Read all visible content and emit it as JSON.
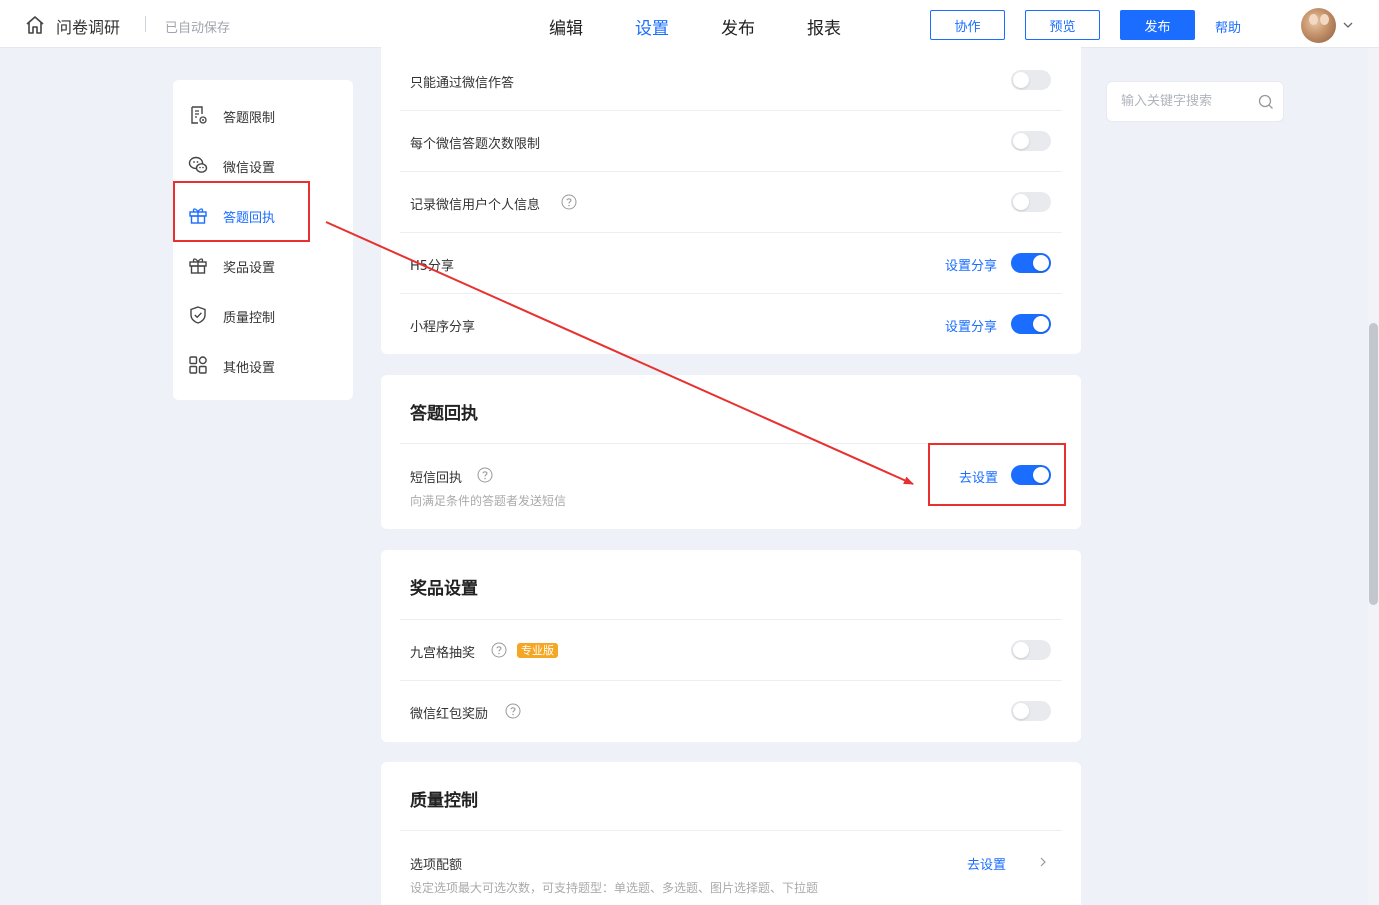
{
  "header": {
    "app_title": "问卷调研",
    "autosave": "已自动保存",
    "tabs": [
      {
        "label": "编辑",
        "active": false
      },
      {
        "label": "设置",
        "active": true
      },
      {
        "label": "发布",
        "active": false
      },
      {
        "label": "报表",
        "active": false
      }
    ],
    "buttons": {
      "collaborate": "协作",
      "preview": "预览",
      "publish": "发布"
    },
    "help": "帮助"
  },
  "sidebar": {
    "items": [
      {
        "label": "答题限制",
        "icon": "doc-settings-icon",
        "active": false
      },
      {
        "label": "微信设置",
        "icon": "wechat-icon",
        "active": false
      },
      {
        "label": "答题回执",
        "icon": "gift-icon",
        "active": true
      },
      {
        "label": "奖品设置",
        "icon": "gift-icon",
        "active": false
      },
      {
        "label": "质量控制",
        "icon": "shield-check-icon",
        "active": false
      },
      {
        "label": "其他设置",
        "icon": "grid-icon",
        "active": false
      }
    ]
  },
  "wechat_section": {
    "rows": [
      {
        "label": "只能通过微信作答",
        "on": false
      },
      {
        "label": "每个微信答题次数限制",
        "on": false
      },
      {
        "label": "记录微信用户个人信息",
        "on": false,
        "help": true
      },
      {
        "label": "H5分享",
        "on": true,
        "link": "设置分享"
      },
      {
        "label": "小程序分享",
        "on": true,
        "link": "设置分享"
      }
    ]
  },
  "receipt_section": {
    "title": "答题回执",
    "sms": {
      "label": "短信回执",
      "desc": "向满足条件的答题者发送短信",
      "link": "去设置",
      "on": true
    }
  },
  "prize_section": {
    "title": "奖品设置",
    "rows": [
      {
        "label": "九宫格抽奖",
        "badge": "专业版",
        "on": false
      },
      {
        "label": "微信红包奖励",
        "on": false
      }
    ]
  },
  "quality_section": {
    "title": "质量控制",
    "option_quota": {
      "label": "选项配额",
      "desc": "设定选项最大可选次数，可支持题型：单选题、多选题、图片选择题、下拉题",
      "link": "去设置"
    }
  },
  "search": {
    "placeholder": "输入关键字搜索"
  },
  "colors": {
    "accent": "#1a6dff",
    "annotation": "#e8302f",
    "badge": "#f5a623"
  }
}
